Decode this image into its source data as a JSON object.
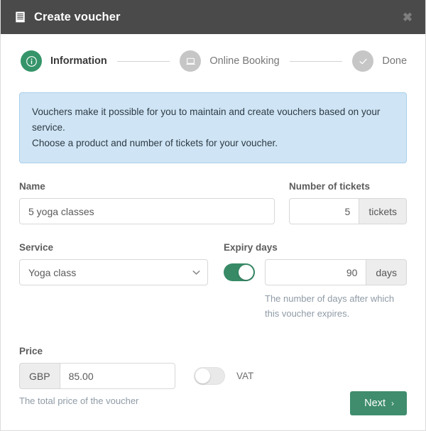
{
  "header": {
    "title": "Create voucher",
    "icon": "voucher-ticket-icon",
    "close_label": "✖",
    "background": "#4a4a4a"
  },
  "theme": {
    "accent_green": "#359469",
    "button_green": "#3f8d6d",
    "inactive_gray": "#c6c6c6",
    "info_bg": "#cfe5f5",
    "info_border": "#a9cfeb"
  },
  "stepper": {
    "steps": [
      {
        "label": "Information",
        "icon": "info-circle-icon",
        "state": "active"
      },
      {
        "label": "Online Booking",
        "icon": "monitor-icon",
        "state": "inactive"
      },
      {
        "label": "Done",
        "icon": "check-icon",
        "state": "inactive"
      }
    ]
  },
  "alert": {
    "line1": "Vouchers make it possible for you to maintain and create vouchers based on your service.",
    "line2": "Choose a product and number of tickets for your voucher."
  },
  "form": {
    "name": {
      "label": "Name",
      "value": "5 yoga classes",
      "placeholder": "Name"
    },
    "tickets": {
      "label": "Number of tickets",
      "value": "5",
      "placeholder": "0",
      "unit": "tickets"
    },
    "service": {
      "label": "Service",
      "value": "Yoga class",
      "options": [
        "Yoga class"
      ]
    },
    "expiry": {
      "label": "Expiry days",
      "toggle_state": "on",
      "value": "90",
      "placeholder": "0",
      "unit": "days",
      "help": "The number of days after which this voucher expires."
    },
    "price": {
      "label": "Price",
      "currency": "GBP",
      "value": "85.00",
      "placeholder": "0.00",
      "help": "The total price of the voucher",
      "vat_label": "VAT",
      "vat_toggle_state": "off"
    }
  },
  "footer": {
    "next_label": "Next",
    "next_chevron": "›"
  }
}
